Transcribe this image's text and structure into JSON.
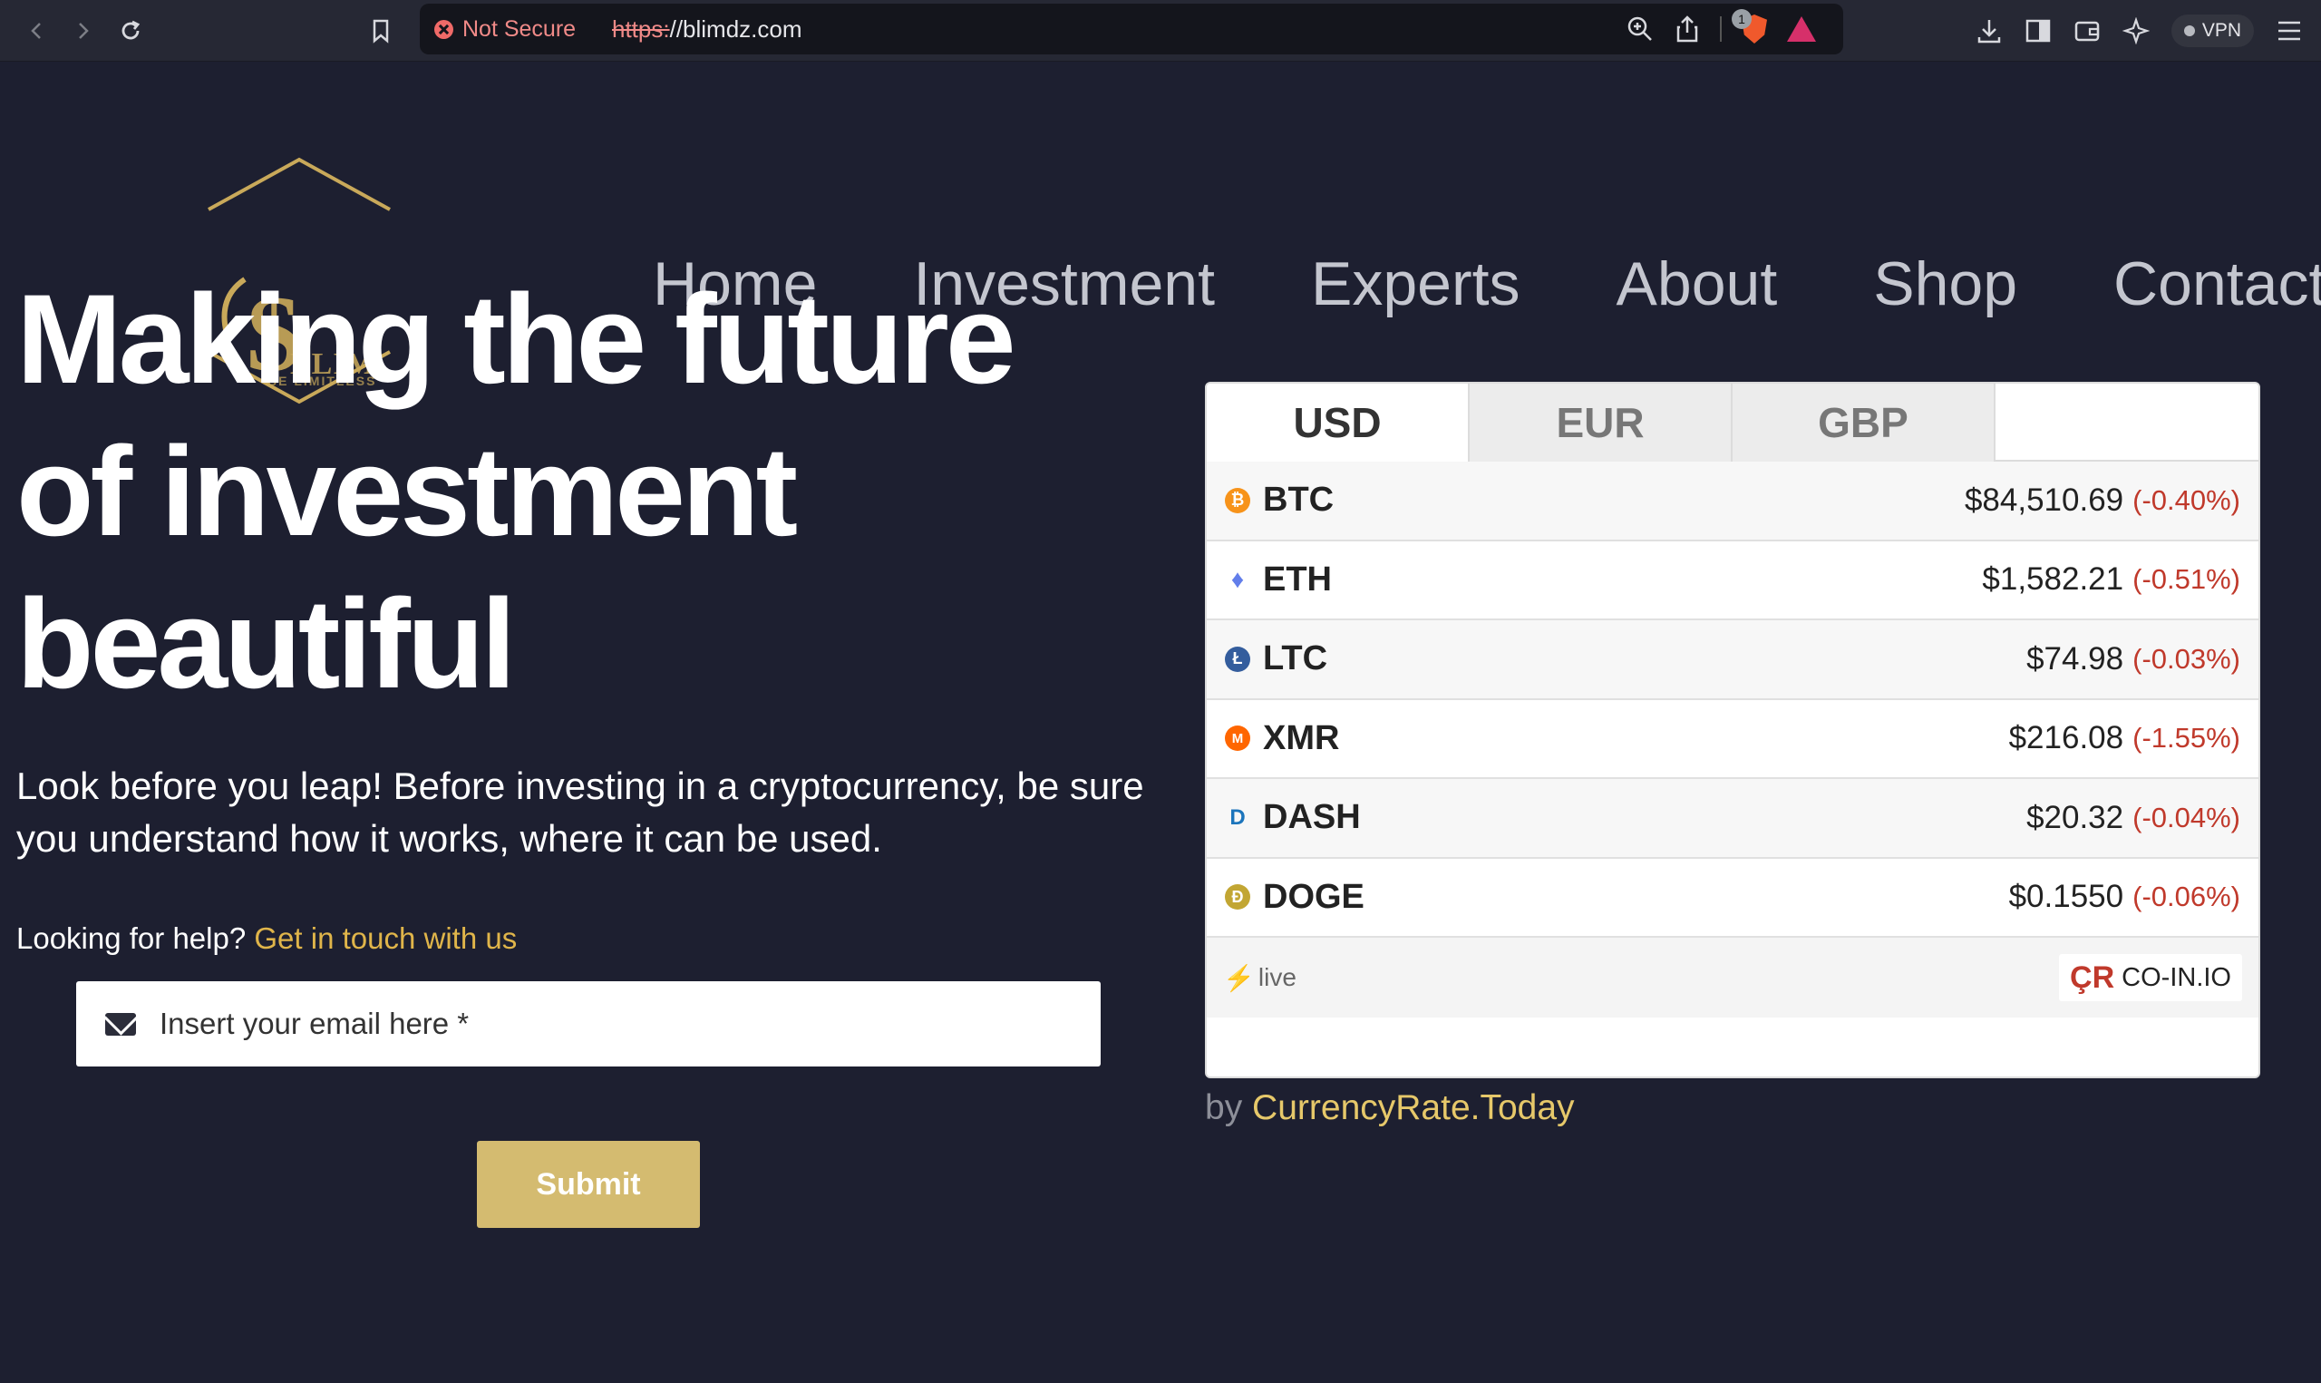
{
  "browser": {
    "url_warning": "Not Secure",
    "url_scheme": "https:",
    "url_rest": "//blimdz.com",
    "brave_badge": "1",
    "vpn_label": "VPN"
  },
  "logo": {
    "text": "BLIM",
    "sub": "BE LIMITLESS",
    "color": "#c9a95a"
  },
  "nav": {
    "home": "Home",
    "investment": "Investment",
    "experts": "Experts",
    "about": "About",
    "shop": "Shop",
    "contact": "Contact"
  },
  "hero": {
    "title_line1": "Making the future",
    "title_line2": "of investment",
    "title_line3": "beautiful",
    "lede": "Look before you leap! Before investing in a cryptocurrency, be sure you understand how it works, where it can be used.",
    "help_prefix": "Looking for help?",
    "help_link": "Get in touch with us"
  },
  "form": {
    "email_placeholder": "Insert your email here *",
    "submit_label": "Submit"
  },
  "widget": {
    "tabs": [
      "USD",
      "EUR",
      "GBP"
    ],
    "rows": [
      {
        "symbol": "BTC",
        "price": "$84,510.69",
        "change": "(-0.40%)",
        "icon_color": "#f7931a",
        "icon_glyph": "₿"
      },
      {
        "symbol": "ETH",
        "price": "$1,582.21",
        "change": "(-0.51%)",
        "icon_color": "#627eea",
        "icon_glyph": "♦"
      },
      {
        "symbol": "LTC",
        "price": "$74.98",
        "change": "(-0.03%)",
        "icon_color": "#345d9d",
        "icon_glyph": "Ł"
      },
      {
        "symbol": "XMR",
        "price": "$216.08",
        "change": "(-1.55%)",
        "icon_color": "#ff6600",
        "icon_glyph": "M"
      },
      {
        "symbol": "DASH",
        "price": "$20.32",
        "change": "(-0.04%)",
        "icon_color": "#1c75bc",
        "icon_glyph": "D"
      },
      {
        "symbol": "DOGE",
        "price": "$0.1550",
        "change": "(-0.06%)",
        "icon_color": "#c2a633",
        "icon_glyph": "Ð"
      }
    ],
    "live_label": "live",
    "provider_mark": "ÇR",
    "provider_name": "CO-IN.IO"
  },
  "byline": {
    "prefix": "by",
    "link": "CurrencyRate.Today"
  },
  "colors": {
    "page_bg": "#1d1f30",
    "accent_gold": "#e0b54a",
    "submit_bg": "#d4bb70",
    "negative": "#c0392b"
  }
}
